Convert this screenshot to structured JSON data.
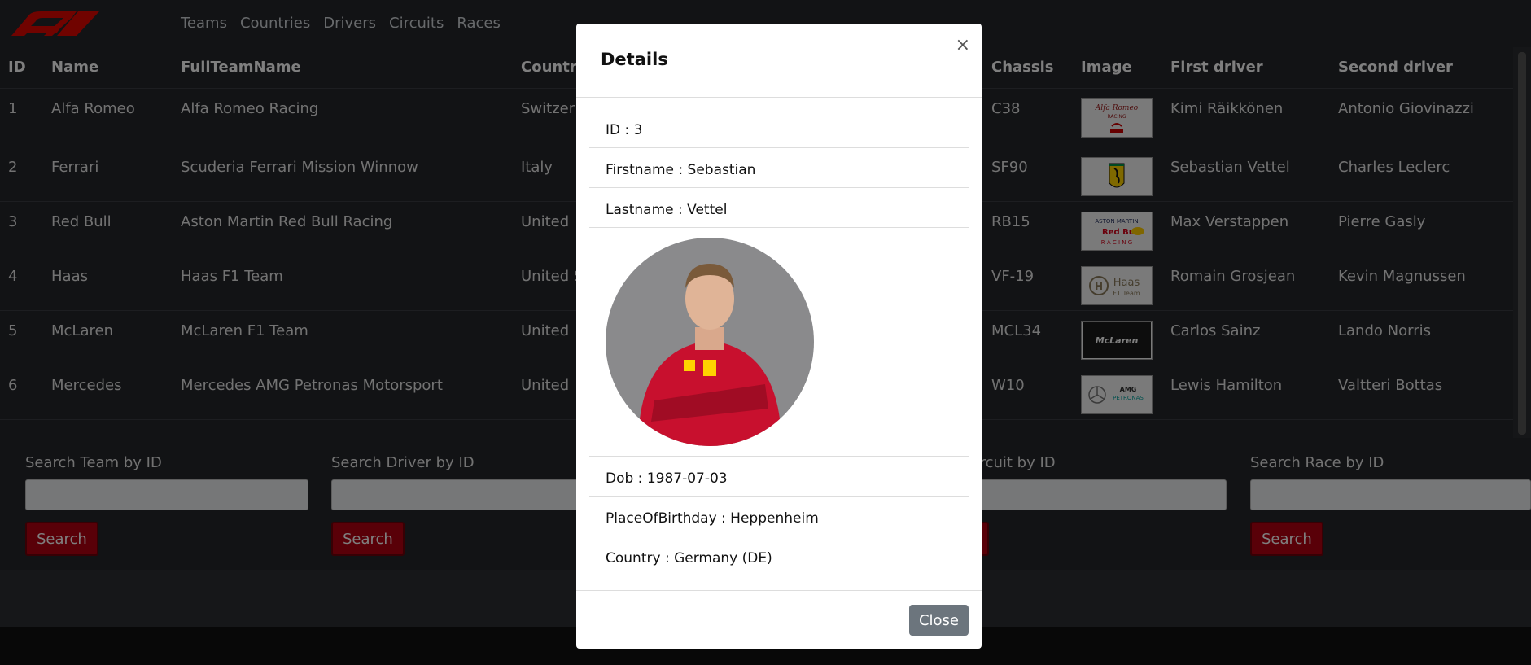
{
  "nav": {
    "links": [
      "Teams",
      "Countries",
      "Drivers",
      "Circuits",
      "Races"
    ]
  },
  "table": {
    "headers": [
      "ID",
      "Name",
      "FullTeamName",
      "Country",
      "Chassis",
      "Image",
      "First driver",
      "Second driver"
    ],
    "rows": [
      {
        "id": "1",
        "name": "Alfa Romeo",
        "full": "Alfa Romeo Racing",
        "country": "Switzer",
        "chassis": "C38",
        "first": "Kimi Räikkönen",
        "second": "Antonio Giovinazzi",
        "logo": "alfa-romeo-logo"
      },
      {
        "id": "2",
        "name": "Ferrari",
        "full": "Scuderia Ferrari Mission Winnow",
        "country": "Italy",
        "chassis": "SF90",
        "first": "Sebastian Vettel",
        "second": "Charles Leclerc",
        "logo": "ferrari-logo"
      },
      {
        "id": "3",
        "name": "Red Bull",
        "full": "Aston Martin Red Bull Racing",
        "country": "United",
        "chassis": "RB15",
        "first": "Max Verstappen",
        "second": "Pierre Gasly",
        "logo": "red-bull-logo"
      },
      {
        "id": "4",
        "name": "Haas",
        "full": "Haas F1 Team",
        "country": "United S",
        "chassis": "VF-19",
        "first": "Romain Grosjean",
        "second": "Kevin Magnussen",
        "logo": "haas-logo"
      },
      {
        "id": "5",
        "name": "McLaren",
        "full": "McLaren F1 Team",
        "country": "United",
        "chassis": "MCL34",
        "first": "Carlos Sainz",
        "second": "Lando Norris",
        "logo": "mclaren-logo"
      },
      {
        "id": "6",
        "name": "Mercedes",
        "full": "Mercedes AMG Petronas Motorsport",
        "country": "United",
        "chassis": "W10",
        "first": "Lewis Hamilton",
        "second": "Valtteri Bottas",
        "logo": "mercedes-logo"
      }
    ]
  },
  "search": [
    {
      "label": "Search Team by ID",
      "button": "Search"
    },
    {
      "label": "Search Driver by ID",
      "button": "Search"
    },
    {
      "label": "ch Circuit by ID",
      "button": "rch"
    },
    {
      "label": "Search Race by ID",
      "button": "Search"
    }
  ],
  "modal": {
    "title": "Details",
    "close_x": "×",
    "id": "ID : 3",
    "firstname": "Firstname : Sebastian",
    "lastname": "Lastname : Vettel",
    "dob": "Dob : 1987-07-03",
    "place": "PlaceOfBirthday : Heppenheim",
    "country": "Country : Germany (DE)",
    "close_label": "Close"
  },
  "colors": {
    "accent": "#b30011",
    "background": "#25272b"
  }
}
